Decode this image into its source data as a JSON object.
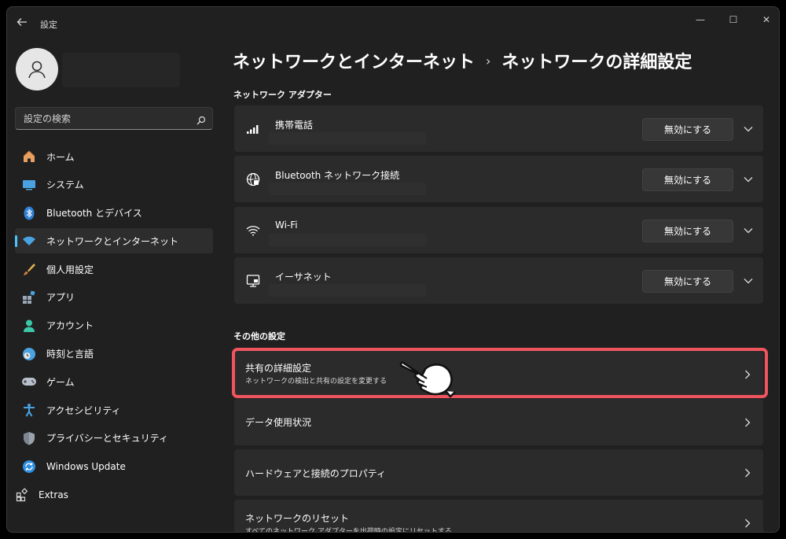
{
  "app": {
    "title": "設定"
  },
  "window_controls": {
    "minimize": "—",
    "maximize": "☐",
    "close": "✕"
  },
  "search": {
    "placeholder": "設定の検索"
  },
  "sidebar": {
    "items": [
      {
        "label": "ホーム",
        "icon": "home-icon"
      },
      {
        "label": "システム",
        "icon": "system-icon"
      },
      {
        "label": "Bluetooth とデバイス",
        "icon": "bluetooth-icon"
      },
      {
        "label": "ネットワークとインターネット",
        "icon": "wifi-icon",
        "active": true
      },
      {
        "label": "個人用設定",
        "icon": "brush-icon"
      },
      {
        "label": "アプリ",
        "icon": "apps-icon"
      },
      {
        "label": "アカウント",
        "icon": "account-icon"
      },
      {
        "label": "時刻と言語",
        "icon": "time-language-icon"
      },
      {
        "label": "ゲーム",
        "icon": "gamepad-icon"
      },
      {
        "label": "アクセシビリティ",
        "icon": "accessibility-icon"
      },
      {
        "label": "プライバシーとセキュリティ",
        "icon": "shield-icon"
      },
      {
        "label": "Windows Update",
        "icon": "update-icon"
      },
      {
        "label": "Extras",
        "icon": "extras-icon"
      }
    ]
  },
  "main": {
    "breadcrumb": {
      "parent": "ネットワークとインターネット",
      "separator": "›",
      "current": "ネットワークの詳細設定"
    },
    "adapters_section": "ネットワーク アダプター",
    "adapters": [
      {
        "name": "携帯電話",
        "button": "無効にする",
        "icon": "cellular-icon"
      },
      {
        "name": "Bluetooth ネットワーク接続",
        "button": "無効にする",
        "icon": "globe-network-icon"
      },
      {
        "name": "Wi-Fi",
        "button": "無効にする",
        "icon": "wifi-icon"
      },
      {
        "name": "イーサネット",
        "button": "無効にする",
        "icon": "ethernet-icon"
      }
    ],
    "other_section": "その他の設定",
    "other": [
      {
        "title": "共有の詳細設定",
        "subtitle": "ネットワークの検出と共有の設定を変更する"
      },
      {
        "title": "データ使用状況",
        "subtitle": ""
      },
      {
        "title": "ハードウェアと接続のプロパティ",
        "subtitle": ""
      },
      {
        "title": "ネットワークのリセット",
        "subtitle": "すべてのネットワーク アダプターを出荷時の設定にリセットする"
      }
    ]
  },
  "colors": {
    "accent": "#4cc2ff",
    "highlight": "#f0555f",
    "background": "#202020",
    "card": "#2b2b2b"
  }
}
